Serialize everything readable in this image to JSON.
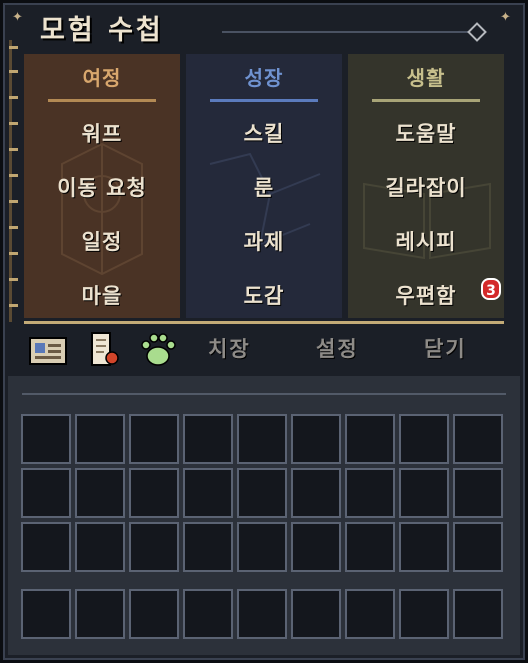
{
  "header": {
    "title": "모험 수첩"
  },
  "columns": [
    {
      "title": "여정",
      "items": [
        "워프",
        "이동 요청",
        "일정",
        "마을"
      ]
    },
    {
      "title": "성장",
      "items": [
        "스킬",
        "룬",
        "과제",
        "도감"
      ]
    },
    {
      "title": "생활",
      "items": [
        "도움말",
        "길라잡이",
        "레시피",
        "우편함"
      ]
    }
  ],
  "mail_badge": "3",
  "bottom_bar": {
    "icons": [
      "id-card-icon",
      "quest-scroll-icon",
      "paw-icon"
    ],
    "labels": [
      "치장",
      "설정",
      "닫기"
    ]
  },
  "inventory": {
    "rows": 4,
    "cols": 9
  },
  "colors": {
    "journey": "#4a3325",
    "growth": "#24293a",
    "life": "#34342b",
    "gold_divider": "#c3ab77",
    "badge": "#d32a2a"
  }
}
